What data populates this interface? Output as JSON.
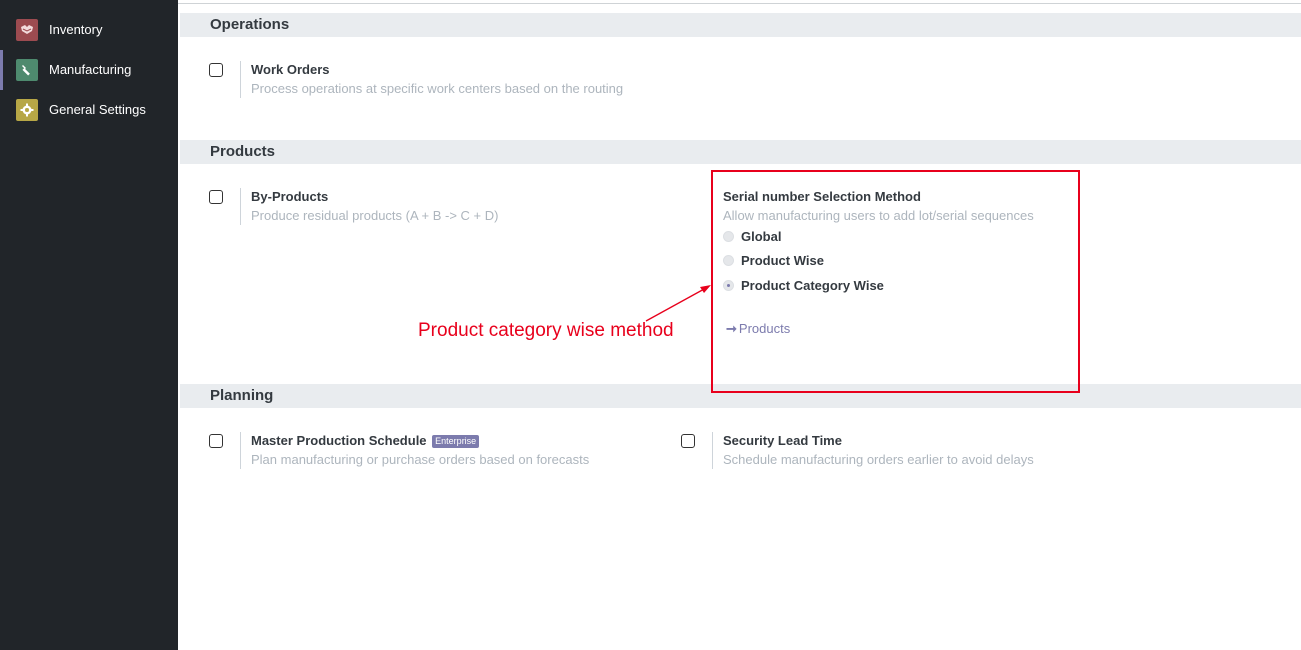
{
  "sidebar": {
    "items": [
      {
        "label": "Inventory",
        "icon": "inventory-icon",
        "color": "#9c4b50"
      },
      {
        "label": "Manufacturing",
        "icon": "wrench-icon",
        "color": "#4e8a6e"
      },
      {
        "label": "General Settings",
        "icon": "gear-icon",
        "color": "#b7a746"
      }
    ]
  },
  "sections": {
    "operations": {
      "title": "Operations",
      "work_orders": {
        "title": "Work Orders",
        "desc": "Process operations at specific work centers based on the routing"
      }
    },
    "products": {
      "title": "Products",
      "by_products": {
        "title": "By-Products",
        "desc": "Produce residual products (A + B -> C + D)"
      },
      "serial": {
        "title": "Serial number Selection Method",
        "desc": "Allow manufacturing users to add lot/serial sequences",
        "options": [
          "Global",
          "Product Wise",
          "Product Category Wise"
        ],
        "selected": "Product Category Wise",
        "link_label": "Products"
      }
    },
    "planning": {
      "title": "Planning",
      "mps": {
        "title": "Master Production Schedule",
        "badge": "Enterprise",
        "desc": "Plan manufacturing or purchase orders based on forecasts"
      },
      "security_lead": {
        "title": "Security Lead Time",
        "desc": "Schedule manufacturing orders earlier to avoid delays"
      }
    }
  },
  "annotation": {
    "text": "Product category wise method",
    "color": "#e8001c"
  },
  "colors": {
    "sidebar_bg": "#212529",
    "accent": "#7c7bad",
    "section_bg": "#e9ecef"
  }
}
